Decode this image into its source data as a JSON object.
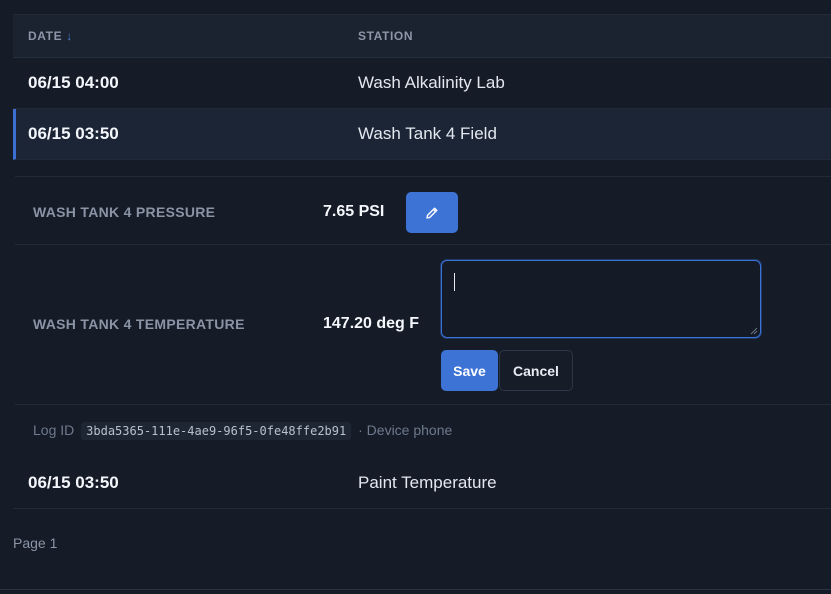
{
  "table": {
    "columns": {
      "date": "DATE",
      "date_sort_indicator": "↓",
      "station": "STATION"
    },
    "rows": [
      {
        "date": "06/15 04:00",
        "station": "Wash Alkalinity Lab"
      },
      {
        "date": "06/15 03:50",
        "station": "Wash Tank 4 Field"
      },
      {
        "date": "06/15 03:50",
        "station": "Paint Temperature"
      }
    ]
  },
  "detail": {
    "pressure": {
      "label": "WASH TANK 4 PRESSURE",
      "value": "7.65 PSI",
      "edit_icon": "pencil-icon"
    },
    "temperature": {
      "label": "WASH TANK 4 TEMPERATURE",
      "value": "147.20 deg F"
    },
    "editor": {
      "value": "",
      "save_label": "Save",
      "cancel_label": "Cancel"
    },
    "meta": {
      "log_id_label": "Log ID",
      "log_id": "3bda5365-111e-4ae9-96f5-0fe48ffe2b91",
      "device_text": "· Device phone"
    }
  },
  "footer": {
    "page_label": "Page 1"
  },
  "colors": {
    "background": "#151b27",
    "accent": "#3d73d4",
    "selected_row": "#1c2536"
  }
}
